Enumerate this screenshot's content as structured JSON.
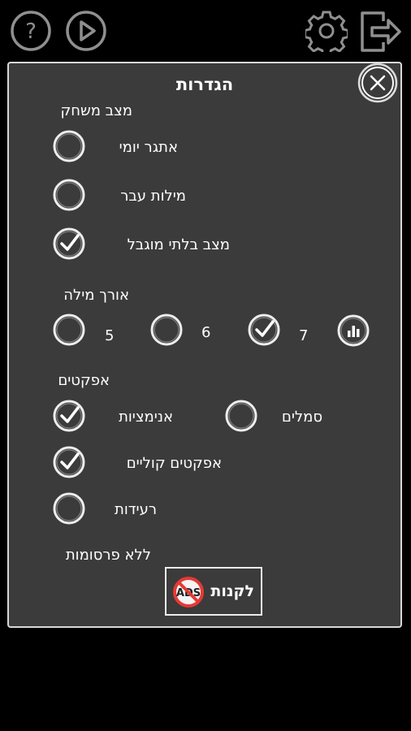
{
  "title": "הגדרות",
  "sections": {
    "game_mode": "מצב משחק",
    "word_length": "אורך מילה",
    "effects": "אפקטים",
    "no_ads": "ללא פרסומות"
  },
  "game_modes": [
    {
      "label": "אתגר יומי",
      "checked": false
    },
    {
      "label": "מילות עבר",
      "checked": false
    },
    {
      "label": "מצב בלתי מוגבל",
      "checked": true
    }
  ],
  "word_lengths": [
    {
      "label": "5",
      "checked": false
    },
    {
      "label": "6",
      "checked": false
    },
    {
      "label": "7",
      "checked": true
    }
  ],
  "effects": {
    "animations": {
      "label": "אנימציות",
      "checked": true
    },
    "symbols": {
      "label": "סמלים",
      "checked": false
    },
    "sound": {
      "label": "אפקטים קוליים",
      "checked": true
    },
    "vibration": {
      "label": "רעידות",
      "checked": false
    }
  },
  "buy_button": {
    "label": "לקנות",
    "badge": "ADS"
  },
  "colors": {
    "panel": "#3b3b3b",
    "border": "#d8d8d8",
    "icon": "#9a9a9a",
    "no_ads_red": "#e53935"
  }
}
